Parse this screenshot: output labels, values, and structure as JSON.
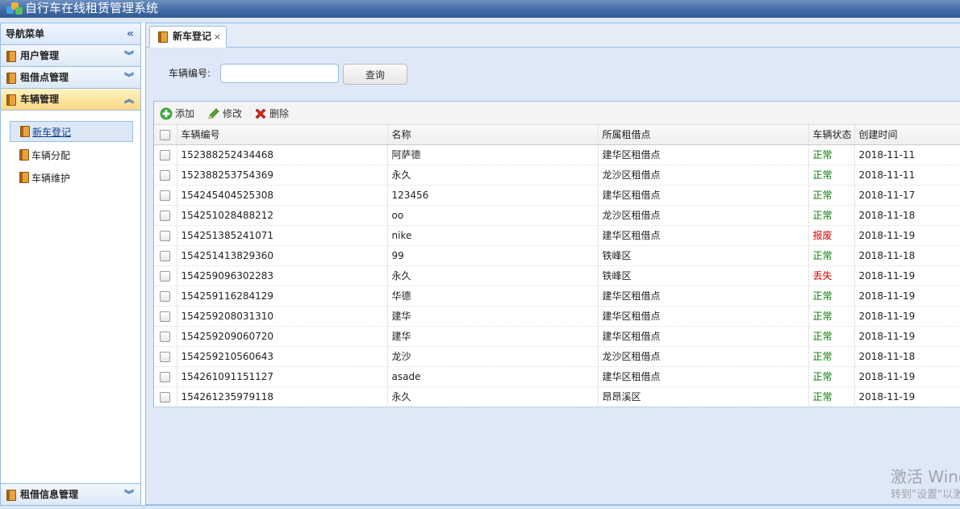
{
  "header": {
    "title": "自行车在线租赁管理系统"
  },
  "sidebar": {
    "title": "导航菜单",
    "collapse_icon": "double-chevron-left-icon",
    "sections": [
      {
        "label": "用户管理",
        "expanded": false
      },
      {
        "label": "租借点管理",
        "expanded": false
      },
      {
        "label": "车辆管理",
        "expanded": true
      },
      {
        "label": "租借信息管理",
        "expanded": false
      }
    ],
    "sub_items": [
      {
        "label": "新车登记",
        "selected": true
      },
      {
        "label": "车辆分配",
        "selected": false
      },
      {
        "label": "车辆维护",
        "selected": false
      }
    ]
  },
  "tabs": [
    {
      "label": "新车登记",
      "close": "×"
    }
  ],
  "search": {
    "label": "车辆编号:",
    "value": "",
    "button": "查询"
  },
  "toolbar": {
    "add": "添加",
    "edit": "修改",
    "delete": "删除"
  },
  "grid": {
    "columns": [
      "车辆编号",
      "名称",
      "所属租借点",
      "车辆状态",
      "创建时间"
    ],
    "rows": [
      [
        "152388252434468",
        "阿萨德",
        "建华区租借点",
        "正常",
        "2018-11-11"
      ],
      [
        "152388253754369",
        "永久",
        "龙沙区租借点",
        "正常",
        "2018-11-11"
      ],
      [
        "154245404525308",
        "123456",
        "建华区租借点",
        "正常",
        "2018-11-17"
      ],
      [
        "154251028488212",
        "oo",
        "龙沙区租借点",
        "正常",
        "2018-11-18"
      ],
      [
        "154251385241071",
        "nike",
        "建华区租借点",
        "报废",
        "2018-11-19"
      ],
      [
        "154251413829360",
        "99",
        "铁峰区",
        "正常",
        "2018-11-18"
      ],
      [
        "154259096302283",
        "永久",
        "铁峰区",
        "丢失",
        "2018-11-19"
      ],
      [
        "154259116284129",
        "华德",
        "建华区租借点",
        "正常",
        "2018-11-19"
      ],
      [
        "154259208031310",
        "建华",
        "建华区租借点",
        "正常",
        "2018-11-19"
      ],
      [
        "154259209060720",
        "建华",
        "建华区租借点",
        "正常",
        "2018-11-19"
      ],
      [
        "154259210560643",
        "龙沙",
        "龙沙区租借点",
        "正常",
        "2018-11-18"
      ],
      [
        "154261091151127",
        "asade",
        "建华区租借点",
        "正常",
        "2018-11-19"
      ],
      [
        "154261235979118",
        "永久",
        "昂昂溪区",
        "正常",
        "2018-11-19"
      ]
    ]
  },
  "colors": {
    "status_ok": "#008000",
    "status_bad": "#e00000",
    "accent": "#3f6aa5"
  },
  "watermark": {
    "line1": "激活 Wind",
    "line2": "转到\"设置\"以激"
  }
}
